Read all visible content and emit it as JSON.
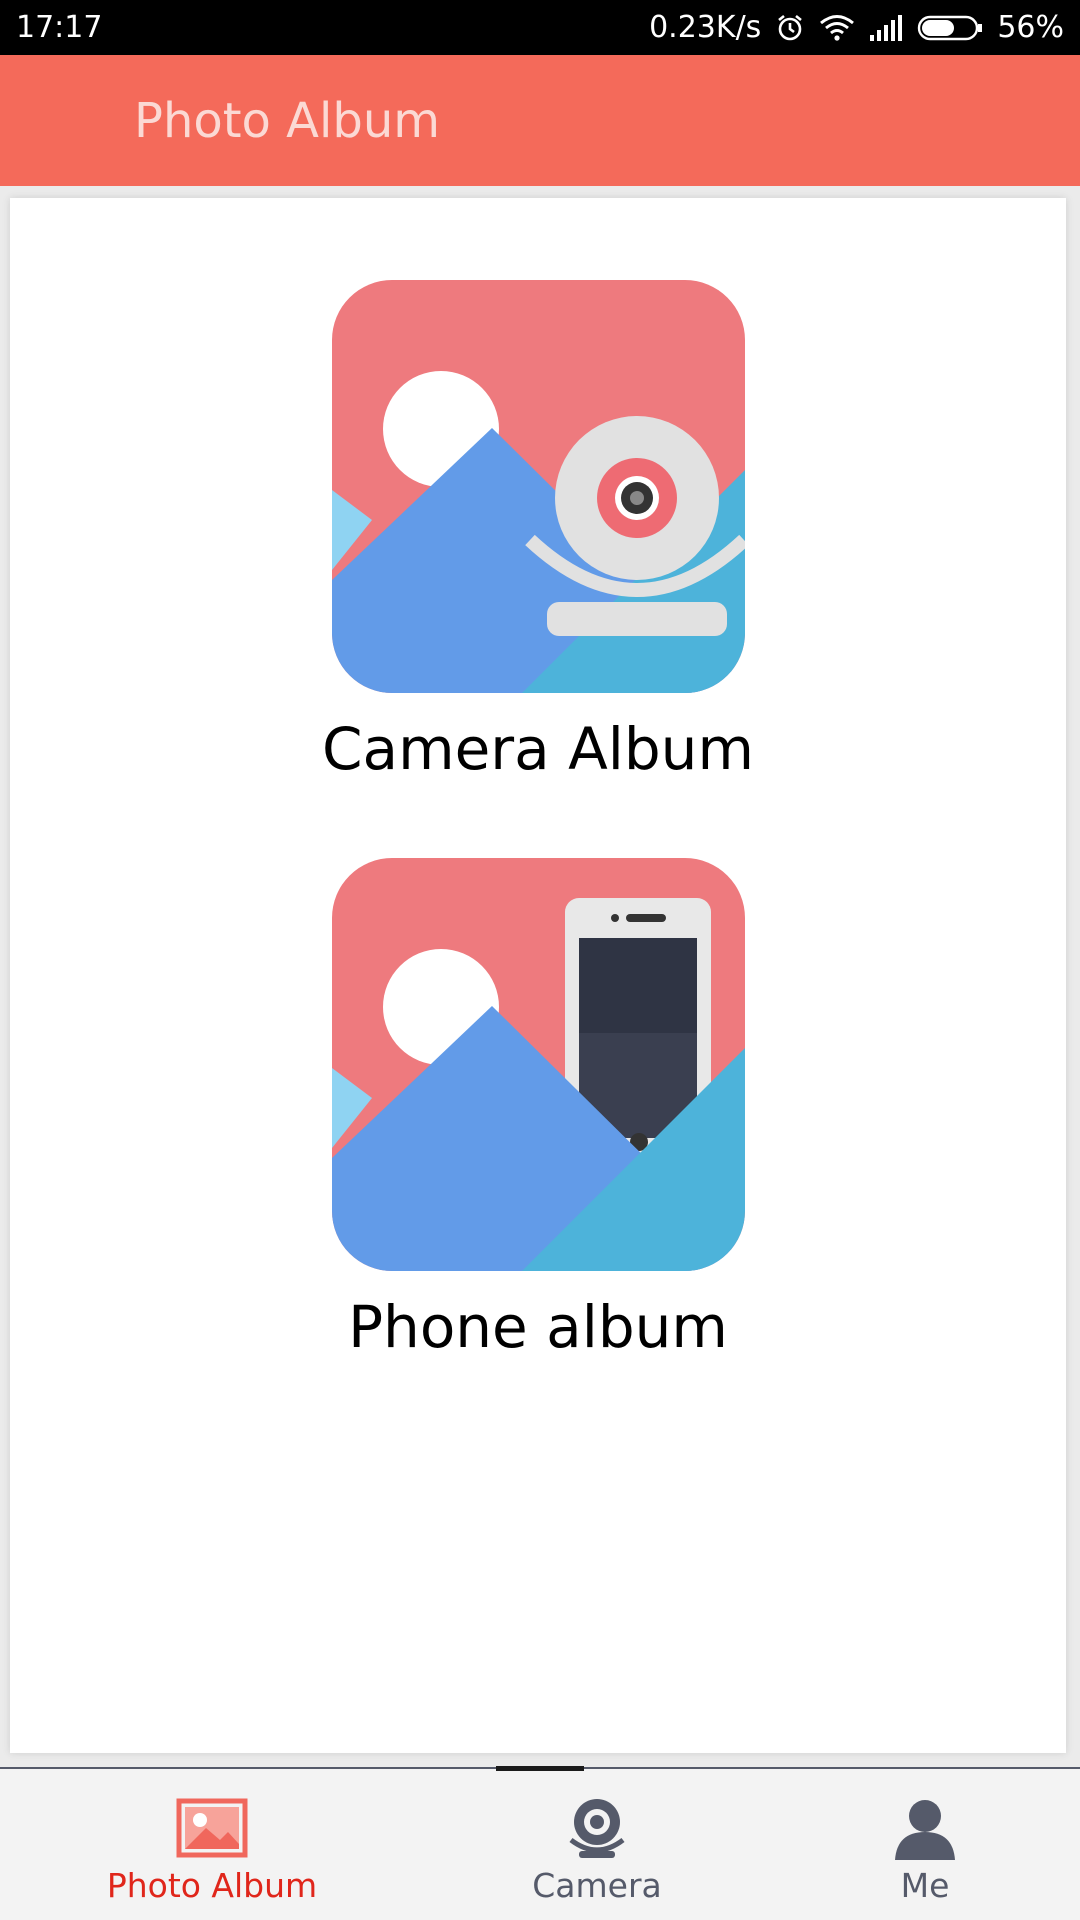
{
  "status_bar": {
    "time": "17:17",
    "network_speed": "0.23K/s",
    "battery": "56%",
    "icons": [
      "alarm-icon",
      "wifi-icon",
      "signal-icon",
      "battery-icon"
    ]
  },
  "title_bar": {
    "title": "Photo Album",
    "background": "#f46a5a"
  },
  "albums": [
    {
      "label": "Camera Album",
      "icon": "camera-album-icon"
    },
    {
      "label": "Phone album",
      "icon": "phone-album-icon"
    }
  ],
  "bottom_nav": {
    "items": [
      {
        "label": "Photo Album",
        "icon": "photo-album-icon",
        "active": true,
        "color": "#e0261b"
      },
      {
        "label": "Camera",
        "icon": "camera-icon",
        "active": false,
        "color": "#555a6a"
      },
      {
        "label": "Me",
        "icon": "user-icon",
        "active": false,
        "color": "#555a6a"
      }
    ]
  }
}
